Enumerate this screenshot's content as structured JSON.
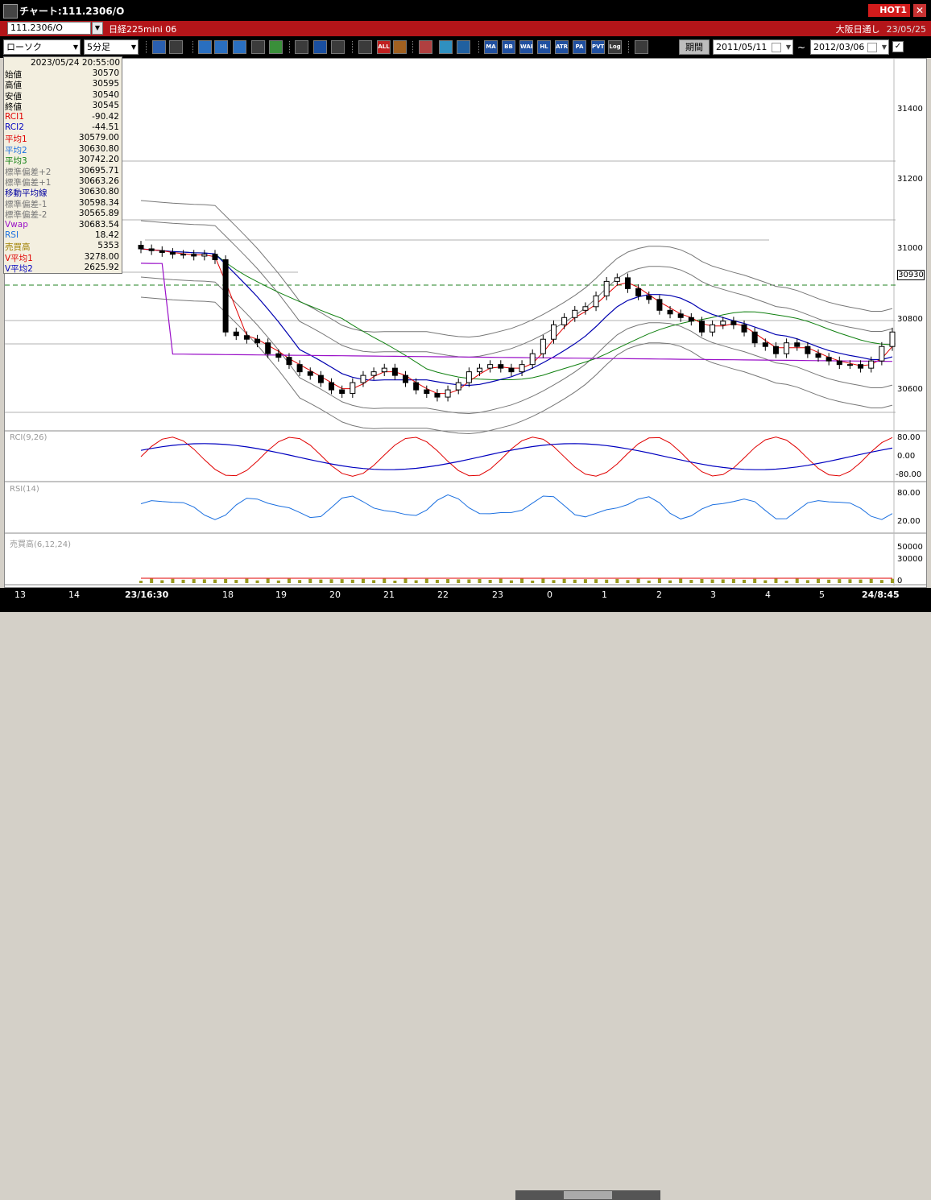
{
  "window": {
    "title": "チャート:111.2306/O",
    "hot_label": "HOT1",
    "close": "✕"
  },
  "symbolbar": {
    "code": "111.2306/O",
    "name": "日経225mini 06",
    "session": "大阪日通し",
    "date": "23/05/25"
  },
  "toolbar": {
    "chart_type": "ローソク",
    "interval": "5分足",
    "buttons": [
      "search",
      "crosshair",
      "zoom-in",
      "zoom-out",
      "fit",
      "period",
      "trend",
      "cursor",
      "arrow",
      "bar-left",
      "bar-right",
      "ALL",
      "settings",
      "color",
      "palette",
      "single",
      "MA",
      "BB",
      "WAE",
      "HL",
      "ATR",
      "PA",
      "PVT",
      "Log",
      "export"
    ],
    "period_label": "期間",
    "date_from": "2011/05/11",
    "tilde": "~",
    "date_to": "2012/03/06"
  },
  "info": {
    "datetime": "2023/05/24  20:55:00",
    "rows": [
      {
        "k": "始値",
        "v": "30570",
        "c": "#000"
      },
      {
        "k": "高値",
        "v": "30595",
        "c": "#000"
      },
      {
        "k": "安値",
        "v": "30540",
        "c": "#000"
      },
      {
        "k": "終値",
        "v": "30545",
        "c": "#000"
      },
      {
        "k": "RCI1",
        "v": "-90.42",
        "c": "#e00000"
      },
      {
        "k": "RCI2",
        "v": "-44.51",
        "c": "#0000c0"
      },
      {
        "k": "平均1",
        "v": "30579.00",
        "c": "#e00000"
      },
      {
        "k": "平均2",
        "v": "30630.80",
        "c": "#1a6fe0"
      },
      {
        "k": "平均3",
        "v": "30742.20",
        "c": "#108010"
      },
      {
        "k": "標準偏差+2",
        "v": "30695.71",
        "c": "#777"
      },
      {
        "k": "標準偏差+1",
        "v": "30663.26",
        "c": "#777"
      },
      {
        "k": "移動平均線",
        "v": "30630.80",
        "c": "#0000a0"
      },
      {
        "k": "標準偏差-1",
        "v": "30598.34",
        "c": "#777"
      },
      {
        "k": "標準偏差-2",
        "v": "30565.89",
        "c": "#777"
      },
      {
        "k": "Vwap",
        "v": "30683.54",
        "c": "#9a10c8"
      },
      {
        "k": "RSI",
        "v": "18.42",
        "c": "#1a6fe0"
      },
      {
        "k": "売買高",
        "v": "5353",
        "c": "#a08000"
      },
      {
        "k": "V平均1",
        "v": "3278.00",
        "c": "#e00000"
      },
      {
        "k": "V平均2",
        "v": "2625.92",
        "c": "#0000c0"
      }
    ]
  },
  "panels": {
    "rci_label": "RCI(9,26)",
    "rsi_label": "RSI(14)",
    "vol_label": "売買高(6,12,24)"
  },
  "price_axis": [
    "31400",
    "31200",
    "31000",
    "30800",
    "30600"
  ],
  "rci_axis": [
    "80.00",
    "0.00",
    "-80.00"
  ],
  "rsi_axis": [
    "80.00",
    "20.00"
  ],
  "vol_axis": [
    "50000",
    "30000",
    "0"
  ],
  "current_price": "30930",
  "x_labels": [
    "13",
    "14",
    "23/16:30",
    "18",
    "19",
    "20",
    "21",
    "22",
    "23",
    "0",
    "1",
    "2",
    "3",
    "4",
    "5",
    "24/8:45"
  ],
  "chart_data": {
    "type": "line",
    "title": "",
    "ylim": [
      30520,
      31500
    ],
    "close": [
      30990,
      30985,
      30980,
      30975,
      30975,
      30970,
      30975,
      30960,
      30760,
      30750,
      30740,
      30730,
      30700,
      30690,
      30670,
      30650,
      30640,
      30620,
      30600,
      30590,
      30620,
      30640,
      30650,
      30660,
      30640,
      30620,
      30600,
      30590,
      30580,
      30600,
      30620,
      30650,
      30660,
      30670,
      30660,
      30650,
      30670,
      30700,
      30740,
      30780,
      30800,
      30820,
      30830,
      30860,
      30900,
      30910,
      30880,
      30860,
      30850,
      30820,
      30810,
      30800,
      30790,
      30760,
      30780,
      30790,
      30780,
      30760,
      30730,
      30720,
      30700,
      30730,
      30720,
      30700,
      30690,
      30680,
      30670,
      30670,
      30660,
      30680,
      30720,
      30760
    ],
    "series": [
      {
        "name": "平均1",
        "color": "#e00000"
      },
      {
        "name": "平均2",
        "color": "#1a6fe0"
      },
      {
        "name": "平均3",
        "color": "#108010"
      },
      {
        "name": "移動平均線",
        "color": "#0000a0"
      },
      {
        "name": "Vwap",
        "color": "#9a10c8"
      }
    ]
  },
  "colors": {
    "title_bg": "#000000",
    "red_bar": "#b31519",
    "hot": "#d21b1b",
    "dash_line": "#208020"
  }
}
